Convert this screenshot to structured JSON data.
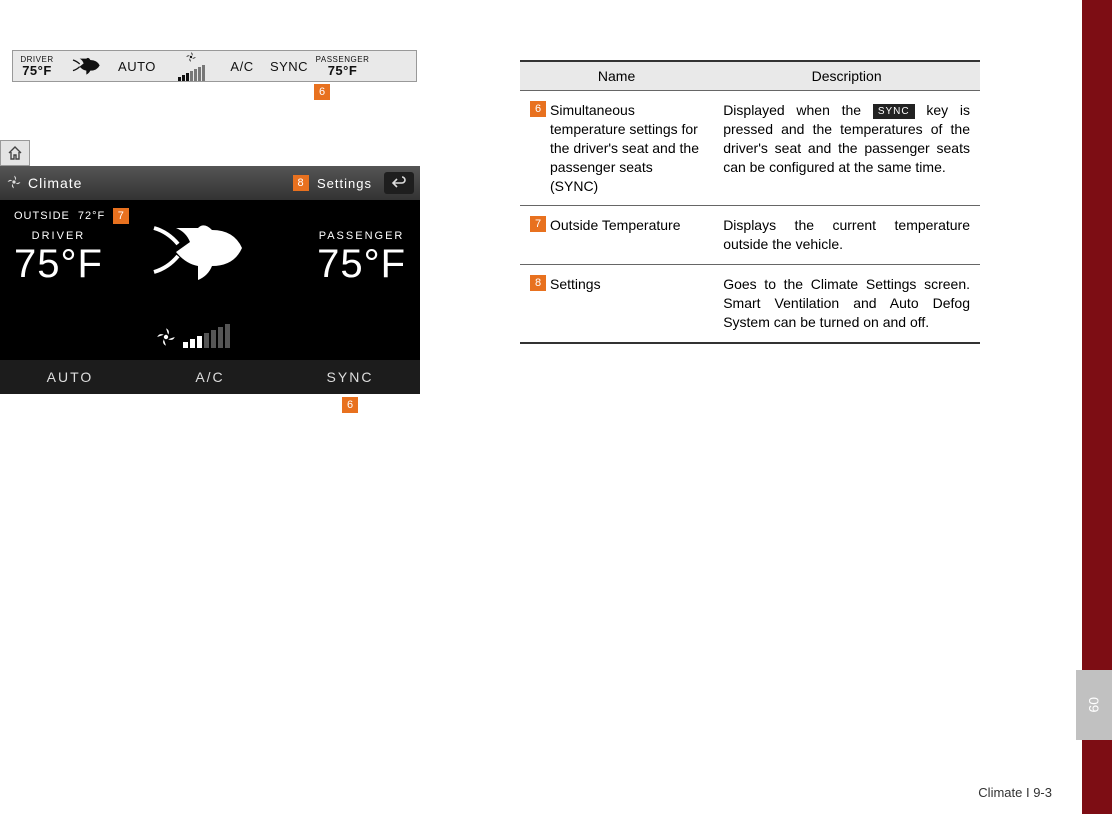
{
  "callouts": {
    "c6": "6",
    "c7": "7",
    "c8": "8"
  },
  "top_bar": {
    "driver_label": "DRIVER",
    "driver_temp": "75°F",
    "auto": "AUTO",
    "ac": "A/C",
    "sync": "SYNC",
    "passenger_label": "PASSENGER",
    "passenger_temp": "75°F"
  },
  "panel": {
    "title": "Climate",
    "settings_label": "Settings",
    "outside_label": "OUTSIDE",
    "outside_temp": "72°F",
    "driver_label": "DRIVER",
    "driver_temp": "75°F",
    "passenger_label": "PASSENGER",
    "passenger_temp": "75°F",
    "bottom": {
      "auto": "AUTO",
      "ac": "A/C",
      "sync": "SYNC"
    }
  },
  "table": {
    "head_name": "Name",
    "head_desc": "Description",
    "rows": [
      {
        "badge": "6",
        "name": "Simultaneous temperature settings for the driver's seat and the passenger seats (SYNC)",
        "desc_pre": "Displayed when the ",
        "desc_key": "SYNC",
        "desc_post": " key is pressed and the temperatures of the driver's seat and the passenger seats can be configured at the same time."
      },
      {
        "badge": "7",
        "name": "Outside Temperature",
        "desc": "Displays the current temperature outside the vehicle."
      },
      {
        "badge": "8",
        "name": "Settings",
        "desc": "Goes to the Climate Settings screen. Smart Ventilation and Auto Defog System can be turned on and off."
      }
    ]
  },
  "side_tab": "09",
  "footer": "Climate I 9-3"
}
